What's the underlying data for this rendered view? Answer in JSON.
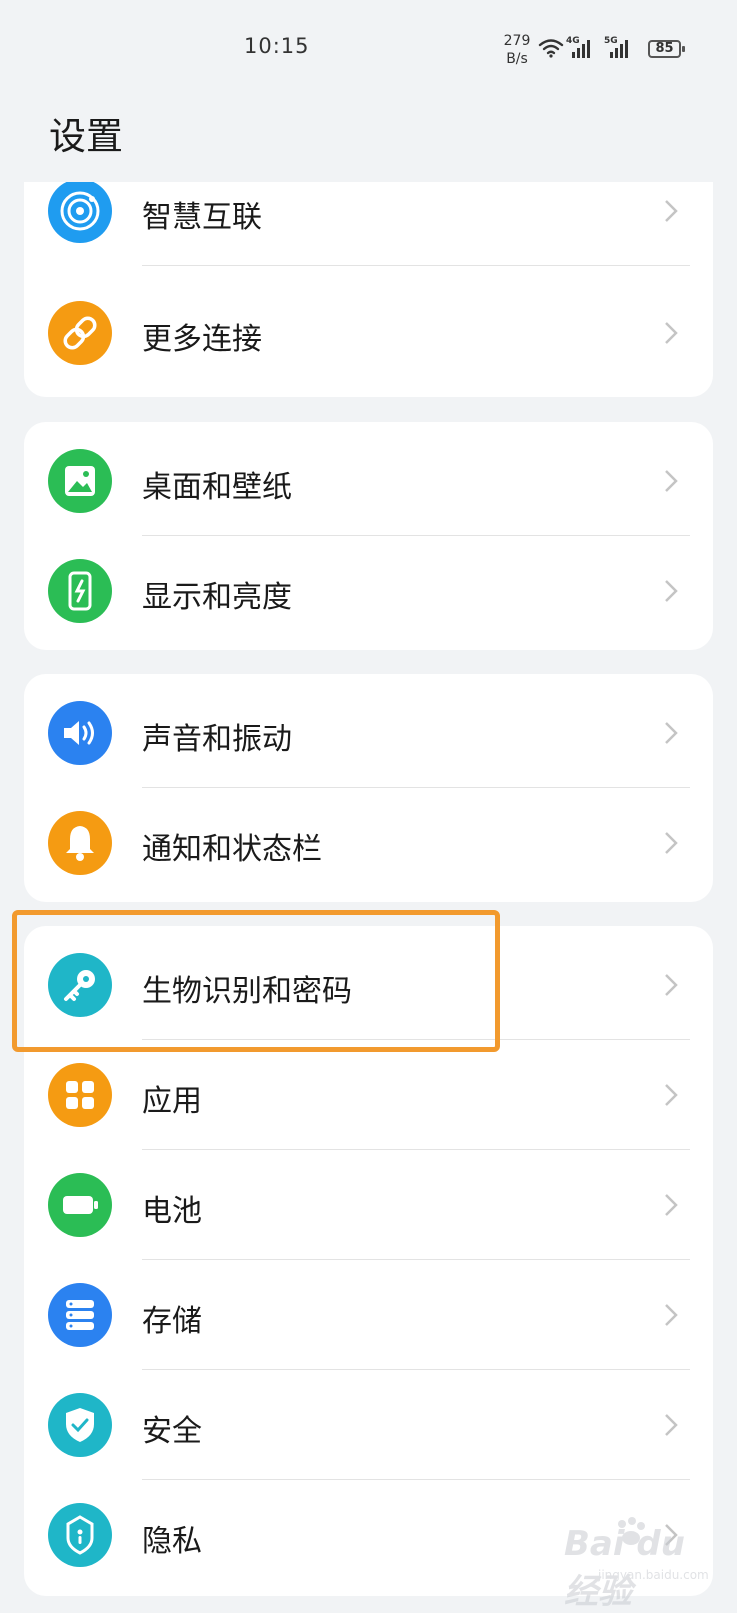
{
  "status_bar": {
    "time": "10:15",
    "net_speed_value": "279",
    "net_speed_unit": "B/s",
    "signal_1_label": "4G",
    "signal_2_label": "5G",
    "battery_level": "85"
  },
  "page": {
    "title": "设置"
  },
  "groups": [
    {
      "items": [
        {
          "label": "智慧互联",
          "icon": "hyperlink-icon",
          "color": "#1f9cf0"
        },
        {
          "label": "更多连接",
          "icon": "link-icon",
          "color": "#f59b12"
        }
      ]
    },
    {
      "items": [
        {
          "label": "桌面和壁纸",
          "icon": "wallpaper-icon",
          "color": "#2bbd55"
        },
        {
          "label": "显示和亮度",
          "icon": "display-icon",
          "color": "#2bbd55"
        }
      ]
    },
    {
      "items": [
        {
          "label": "声音和振动",
          "icon": "speaker-icon",
          "color": "#2b82f0"
        },
        {
          "label": "通知和状态栏",
          "icon": "bell-icon",
          "color": "#f59b12"
        }
      ]
    },
    {
      "items": [
        {
          "label": "生物识别和密码",
          "icon": "key-icon",
          "color": "#1fb6c8"
        },
        {
          "label": "应用",
          "icon": "apps-icon",
          "color": "#f59b12"
        },
        {
          "label": "电池",
          "icon": "battery-icon",
          "color": "#2bbd55"
        },
        {
          "label": "存储",
          "icon": "storage-icon",
          "color": "#2b82f0"
        },
        {
          "label": "安全",
          "icon": "shield-icon",
          "color": "#1fb6c8"
        },
        {
          "label": "隐私",
          "icon": "privacy-lock-icon",
          "color": "#1fb6c8"
        }
      ]
    }
  ],
  "highlight_color": "#f29a2e",
  "watermark": {
    "brand": "Bai du 经验",
    "site": "jingyan.baidu.com"
  }
}
